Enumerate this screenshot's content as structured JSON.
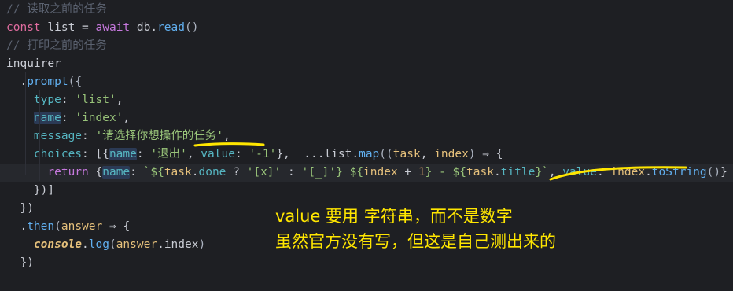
{
  "code_lines": [
    {
      "kind": "comment",
      "text": "// 读取之前的任务"
    },
    {
      "kind": "code",
      "parts": [
        [
          "kw",
          "const"
        ],
        [
          "op",
          " list = "
        ],
        [
          "kw2",
          "await"
        ],
        [
          "op",
          " db."
        ],
        [
          "fn",
          "read"
        ],
        [
          "punc",
          "()"
        ]
      ]
    },
    {
      "kind": "comment",
      "text": "// 打印之前的任务"
    },
    {
      "kind": "code",
      "parts": [
        [
          "op",
          "inquirer"
        ]
      ]
    },
    {
      "kind": "code",
      "parts": [
        [
          "op",
          "  ."
        ],
        [
          "fn",
          "prompt"
        ],
        [
          "punc",
          "({"
        ]
      ]
    },
    {
      "kind": "code",
      "parts": [
        [
          "prop",
          "    type"
        ],
        [
          "op",
          ": "
        ],
        [
          "str",
          "'list'"
        ],
        [
          "op",
          ","
        ]
      ]
    },
    {
      "kind": "code",
      "parts": [
        [
          "op",
          "    "
        ],
        [
          "prop-hl",
          "name"
        ],
        [
          "op",
          ": "
        ],
        [
          "str",
          "'index'"
        ],
        [
          "op",
          ","
        ]
      ]
    },
    {
      "kind": "code",
      "parts": [
        [
          "prop",
          "    message"
        ],
        [
          "op",
          ": "
        ],
        [
          "str",
          "'请选择你想操作的任务'"
        ],
        [
          "op",
          ","
        ]
      ]
    },
    {
      "kind": "code",
      "parts": [
        [
          "prop",
          "    choices"
        ],
        [
          "op",
          ": [{"
        ],
        [
          "prop-hl",
          "name"
        ],
        [
          "op",
          ": "
        ],
        [
          "str",
          "'退出'"
        ],
        [
          "op",
          ", "
        ],
        [
          "prop",
          "value"
        ],
        [
          "op",
          ": "
        ],
        [
          "str",
          "'-1'"
        ],
        [
          "op",
          "},  ..."
        ],
        [
          "op",
          "list."
        ],
        [
          "fn",
          "map"
        ],
        [
          "punc",
          "(("
        ],
        [
          "var",
          "task"
        ],
        [
          "op",
          ", "
        ],
        [
          "var",
          "index"
        ],
        [
          "punc",
          ")"
        ],
        [
          "op",
          " ⇒ {"
        ]
      ]
    },
    {
      "kind": "code",
      "active": true,
      "parts": [
        [
          "kw2",
          "      return"
        ],
        [
          "op",
          " {"
        ],
        [
          "prop-hl",
          "name"
        ],
        [
          "op",
          ": "
        ],
        [
          "tmpl",
          "`${"
        ],
        [
          "var",
          "task"
        ],
        [
          "op",
          "."
        ],
        [
          "prop",
          "done"
        ],
        [
          "op",
          " ? "
        ],
        [
          "str",
          "'[x]'"
        ],
        [
          "op",
          " : "
        ],
        [
          "str",
          "'[_]'"
        ],
        [
          "tmpl",
          "} ${"
        ],
        [
          "var",
          "index"
        ],
        [
          "op",
          " + "
        ],
        [
          "num",
          "1"
        ],
        [
          "tmpl",
          "} - ${"
        ],
        [
          "var",
          "task"
        ],
        [
          "op",
          "."
        ],
        [
          "prop",
          "title"
        ],
        [
          "tmpl",
          "}`"
        ],
        [
          "op",
          ", "
        ],
        [
          "prop",
          "value"
        ],
        [
          "op",
          ": "
        ],
        [
          "var",
          "index"
        ],
        [
          "op",
          "."
        ],
        [
          "fn",
          "toString"
        ],
        [
          "punc",
          "()"
        ],
        [
          "op",
          "}"
        ]
      ]
    },
    {
      "kind": "code",
      "parts": [
        [
          "op",
          "    })]"
        ]
      ]
    },
    {
      "kind": "code",
      "parts": [
        [
          "op",
          "  })"
        ]
      ]
    },
    {
      "kind": "code",
      "parts": [
        [
          "op",
          "  ."
        ],
        [
          "fn",
          "then"
        ],
        [
          "punc",
          "("
        ],
        [
          "var",
          "answer"
        ],
        [
          "op",
          " ⇒ {"
        ]
      ]
    },
    {
      "kind": "code",
      "parts": [
        [
          "op",
          "    "
        ],
        [
          "bold-it",
          "console"
        ],
        [
          "op",
          "."
        ],
        [
          "fn",
          "log"
        ],
        [
          "punc",
          "("
        ],
        [
          "var",
          "answer"
        ],
        [
          "op",
          ".index"
        ],
        [
          "punc",
          ")"
        ]
      ]
    },
    {
      "kind": "code",
      "parts": [
        [
          "op",
          "  })"
        ]
      ]
    }
  ],
  "annotation": {
    "line1": "value 要用 字符串，而不是数字",
    "line2": "虽然官方没有写，但这是自己测出来的"
  },
  "colors": {
    "background": "#1e1f23",
    "annotation": "#ffe600"
  }
}
